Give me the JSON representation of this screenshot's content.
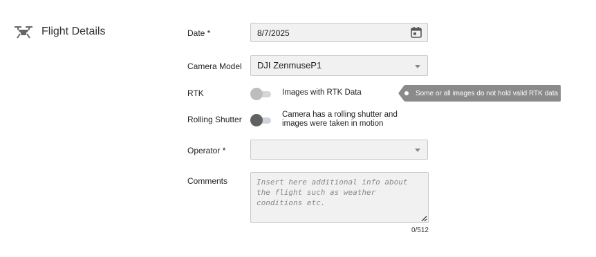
{
  "section": {
    "title": "Flight Details",
    "icon": "drone-icon"
  },
  "date": {
    "label": "Date *",
    "value": "8/7/2025",
    "icon": "calendar-icon"
  },
  "camera_model": {
    "label": "Camera Model",
    "value": "DJI ZenmuseP1"
  },
  "rtk": {
    "label": "RTK",
    "toggle_text": "Images with RTK Data",
    "enabled": false,
    "tooltip": "Some or all images do not hold valid RTK data"
  },
  "rolling_shutter": {
    "label": "Rolling Shutter",
    "toggle_text_line1": "Camera has a rolling shutter and",
    "toggle_text_line2": "images were taken in motion",
    "enabled": false
  },
  "operator": {
    "label": "Operator *",
    "value": ""
  },
  "comments": {
    "label": "Comments",
    "placeholder": "Insert here additional info about the flight such as weather conditions etc.",
    "counter": "0/512"
  },
  "colors": {
    "tooltip_bg": "#8a8a8a",
    "field_bg": "#f1f1f1",
    "toggle_dark": "#616161"
  }
}
